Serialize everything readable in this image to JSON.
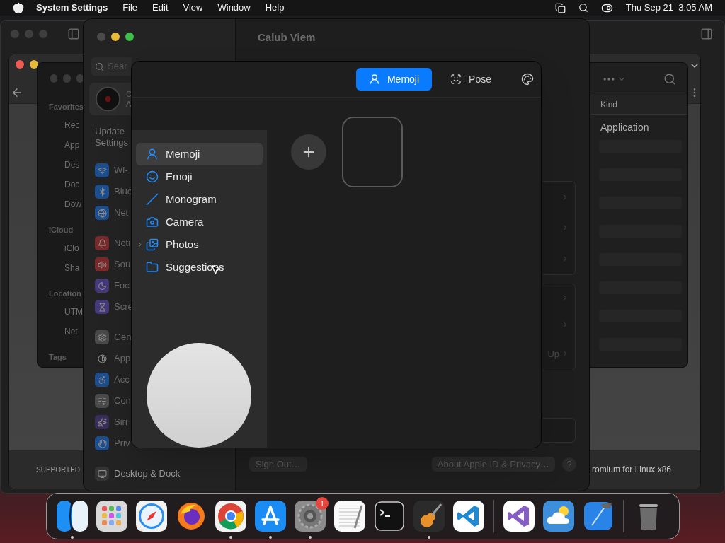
{
  "menu_bar": {
    "app": "System Settings",
    "menus": [
      "File",
      "Edit",
      "View",
      "Window",
      "Help"
    ],
    "clock": "Thu Sep 21  3:05 AM"
  },
  "back_window": {
    "footer_left": "SUPPORTED",
    "footer_right": "romium for Linux x86"
  },
  "finder": {
    "sidebar": [
      {
        "heading": "Favorites",
        "items": [
          "Rec",
          "App",
          "Des",
          "Doc",
          "Dow"
        ]
      },
      {
        "heading": "iCloud",
        "items": [
          "iClo",
          "Sha"
        ]
      },
      {
        "heading": "Location",
        "items": [
          "UTM",
          "Net"
        ]
      },
      {
        "heading": "Tags"
      }
    ],
    "column": "Kind",
    "rows": [
      "Application"
    ]
  },
  "settings": {
    "title": "Calub Viem",
    "search": {
      "placeholder": "Sear"
    },
    "account": {
      "line_1": "C",
      "line_2": "A"
    },
    "update_notice": [
      "Update",
      "Settings"
    ],
    "sidebar": [
      {
        "kind": "wifi",
        "label": "Wi-"
      },
      {
        "kind": "bluetooth",
        "label": "Blue"
      },
      {
        "kind": "network",
        "label": "Net"
      },
      {
        "kind": "notifications",
        "label": "Noti"
      },
      {
        "kind": "sound",
        "label": "Sou"
      },
      {
        "kind": "focus",
        "label": "Foc"
      },
      {
        "kind": "screentime",
        "label": "Scre"
      },
      {
        "kind": "general",
        "label": "Gen"
      },
      {
        "kind": "appearance",
        "label": "App"
      },
      {
        "kind": "accessibility",
        "label": "Acc"
      },
      {
        "kind": "control",
        "label": "Con"
      },
      {
        "kind": "siri",
        "label": "Siri"
      },
      {
        "kind": "privacy",
        "label": "Priv"
      },
      {
        "kind": "dock",
        "label": "Desktop & Dock"
      }
    ],
    "partial_label": "Up",
    "buttons": [
      "Sign Out…",
      "About Apple ID & Privacy…"
    ],
    "help": "?"
  },
  "picker": {
    "tabs": [
      {
        "kind": "memoji",
        "label": "Memoji",
        "selected": true
      },
      {
        "kind": "pose",
        "label": "Pose",
        "selected": false
      }
    ],
    "sidebar": [
      {
        "kind": "memoji",
        "label": "Memoji",
        "selected": true
      },
      {
        "kind": "emoji",
        "label": "Emoji",
        "selected": false
      },
      {
        "kind": "monogram",
        "label": "Monogram",
        "selected": false
      },
      {
        "kind": "camera",
        "label": "Camera",
        "selected": false
      },
      {
        "kind": "photos",
        "label": "Photos",
        "selected": false,
        "expanded": false
      },
      {
        "kind": "folder",
        "label": "Suggestions",
        "selected": false
      }
    ]
  },
  "dock": {
    "sections": [
      {
        "apps": [
          {
            "kind": "finder",
            "running": true
          },
          {
            "kind": "launchpad",
            "running": false
          },
          {
            "kind": "safari",
            "running": false
          },
          {
            "kind": "firefox",
            "running": false
          },
          {
            "kind": "chrome",
            "running": true
          },
          {
            "kind": "appstore",
            "running": true
          },
          {
            "kind": "settings",
            "running": true,
            "badge": "1"
          },
          {
            "kind": "textedit",
            "running": false
          },
          {
            "kind": "terminal",
            "running": false
          },
          {
            "kind": "garageband",
            "running": true
          },
          {
            "kind": "vscode",
            "running": false
          }
        ]
      },
      {
        "apps": [
          {
            "kind": "visualstudio",
            "running": false
          },
          {
            "kind": "weather",
            "running": false
          },
          {
            "kind": "xcode",
            "running": false
          }
        ]
      },
      {
        "apps": [
          {
            "kind": "trash",
            "running": false
          }
        ]
      }
    ]
  }
}
